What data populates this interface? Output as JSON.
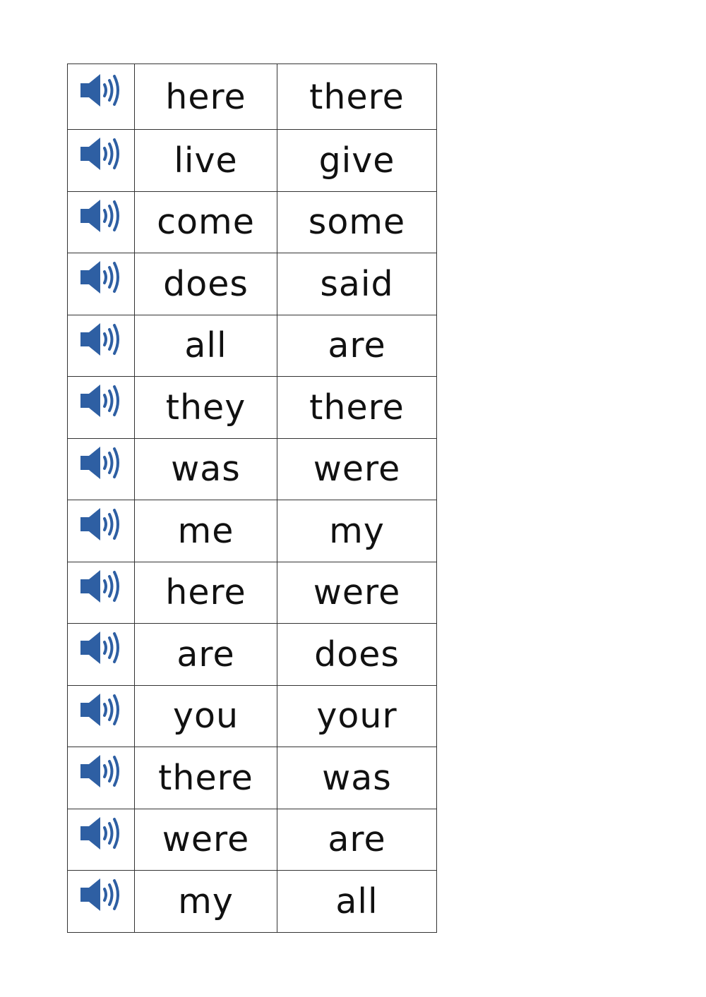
{
  "icon": {
    "name": "speaker-icon",
    "color": "#2e5fa3"
  },
  "rows": [
    {
      "word1": "here",
      "word2": "there"
    },
    {
      "word1": "live",
      "word2": "give"
    },
    {
      "word1": "come",
      "word2": "some"
    },
    {
      "word1": "does",
      "word2": "said"
    },
    {
      "word1": "all",
      "word2": "are"
    },
    {
      "word1": "they",
      "word2": "there"
    },
    {
      "word1": "was",
      "word2": "were"
    },
    {
      "word1": "me",
      "word2": "my"
    },
    {
      "word1": "here",
      "word2": "were"
    },
    {
      "word1": "are",
      "word2": "does"
    },
    {
      "word1": "you",
      "word2": "your"
    },
    {
      "word1": "there",
      "word2": "was"
    },
    {
      "word1": "were",
      "word2": "are"
    },
    {
      "word1": "my",
      "word2": "all"
    }
  ]
}
